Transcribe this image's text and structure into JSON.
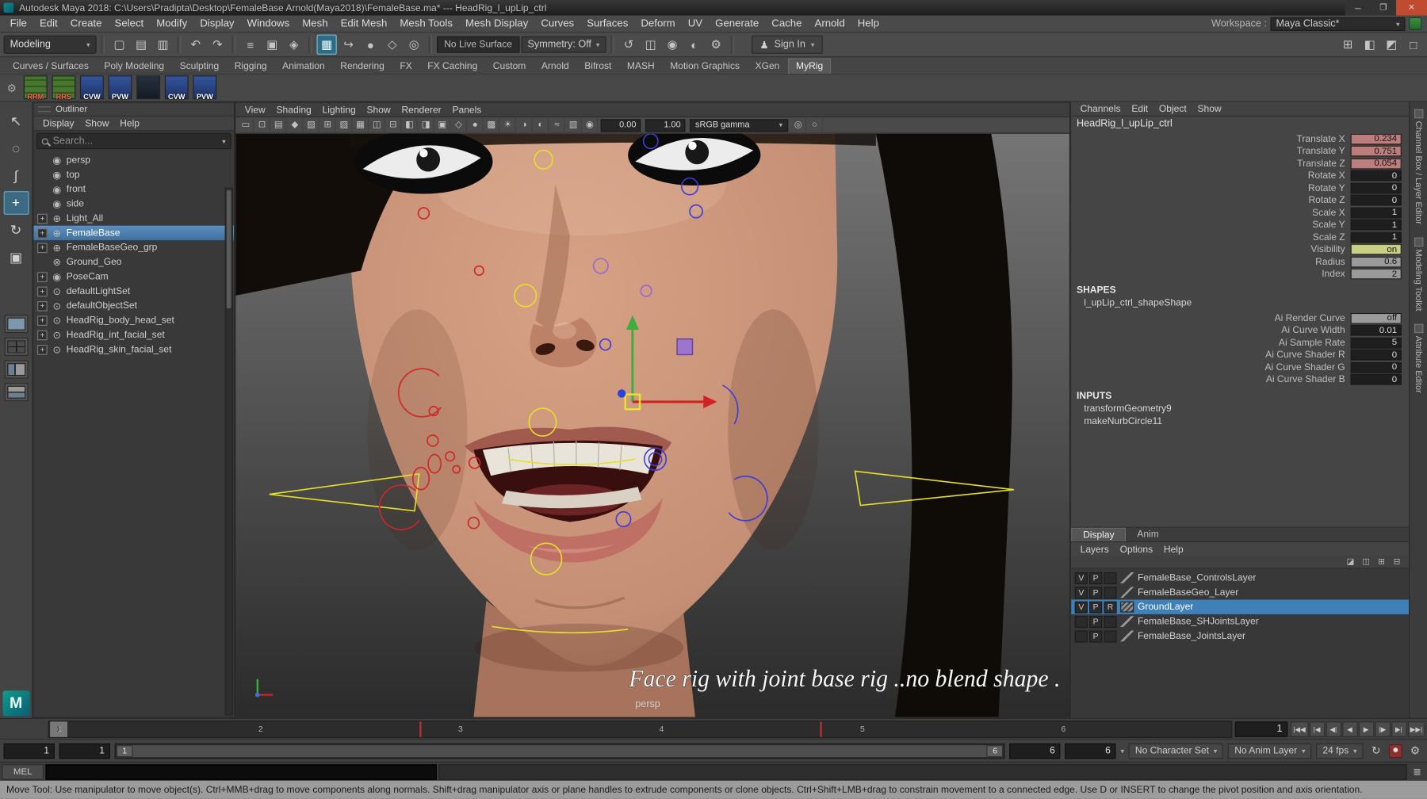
{
  "title_bar": {
    "title": "Autodesk Maya 2018: C:\\Users\\Pradipta\\Desktop\\FemaleBase Arnold(Maya2018)\\FemaleBase.ma*   ---   HeadRig_l_upLip_ctrl",
    "minimize": "─",
    "maximize": "❐",
    "close": "✕"
  },
  "menu_bar": {
    "items": [
      "File",
      "Edit",
      "Create",
      "Select",
      "Modify",
      "Display",
      "Windows",
      "Mesh",
      "Edit Mesh",
      "Mesh Tools",
      "Mesh Display",
      "Curves",
      "Surfaces",
      "Deform",
      "UV",
      "Generate",
      "Cache",
      "Arnold",
      "Help"
    ],
    "workspace_label": "Workspace :",
    "workspace_value": "Maya Classic*"
  },
  "status_line": {
    "mode": "Modeling",
    "live_surface": "No Live Surface",
    "symmetry": "Symmetry: Off",
    "sign_in": "Sign In",
    "icons": [
      {
        "name": "separator",
        "cls": "sep",
        "glyph": ""
      },
      {
        "name": "new-scene-icon",
        "cls": "",
        "glyph": "▢"
      },
      {
        "name": "open-scene-icon",
        "cls": "",
        "glyph": "▤"
      },
      {
        "name": "save-scene-icon",
        "cls": "",
        "glyph": "▥"
      },
      {
        "name": "separator",
        "cls": "sep",
        "glyph": ""
      },
      {
        "name": "undo-icon",
        "cls": "",
        "glyph": "↶"
      },
      {
        "name": "redo-icon",
        "cls": "",
        "glyph": "↷"
      },
      {
        "name": "separator",
        "cls": "sep",
        "glyph": ""
      },
      {
        "name": "select-by-hierarchy-icon",
        "cls": "",
        "glyph": "≡"
      },
      {
        "name": "select-by-object-icon",
        "cls": "",
        "glyph": "▣"
      },
      {
        "name": "select-by-component-icon",
        "cls": "",
        "glyph": "◈"
      },
      {
        "name": "separator",
        "cls": "sep",
        "glyph": ""
      },
      {
        "name": "snap-to-grid-icon",
        "cls": "active",
        "glyph": "▦"
      },
      {
        "name": "snap-to-curve-icon",
        "cls": "",
        "glyph": "↪"
      },
      {
        "name": "snap-to-point-icon",
        "cls": "",
        "glyph": "●"
      },
      {
        "name": "snap-to-plane-icon",
        "cls": "",
        "glyph": "◇"
      },
      {
        "name": "make-live-icon",
        "cls": "",
        "glyph": "◎"
      },
      {
        "name": "separator",
        "cls": "sep",
        "glyph": ""
      }
    ],
    "icons2": [
      {
        "name": "separator",
        "cls": "sep",
        "glyph": ""
      },
      {
        "name": "construction-history-icon",
        "cls": "",
        "glyph": "↺"
      },
      {
        "name": "open-render-view-icon",
        "cls": "",
        "glyph": "◫"
      },
      {
        "name": "render-current-frame-icon",
        "cls": "",
        "glyph": "◉"
      },
      {
        "name": "ipr-render-icon",
        "cls": "",
        "glyph": "◐"
      },
      {
        "name": "render-settings-icon",
        "cls": "",
        "glyph": "⚙"
      },
      {
        "name": "separator",
        "cls": "sep",
        "glyph": ""
      }
    ],
    "right_icons": [
      {
        "name": "toggle-grid-icon",
        "cls": "",
        "glyph": "⊞"
      },
      {
        "name": "toggle-panel-layout-icon",
        "cls": "",
        "glyph": "◧"
      },
      {
        "name": "toggle-viewcube-icon",
        "cls": "",
        "glyph": "◩"
      },
      {
        "name": "toggle-fullscreen-icon",
        "cls": "",
        "glyph": "□"
      }
    ]
  },
  "shelf": {
    "tabs": [
      {
        "label": "Curves / Surfaces",
        "cls": ""
      },
      {
        "label": "Poly Modeling",
        "cls": ""
      },
      {
        "label": "Sculpting",
        "cls": ""
      },
      {
        "label": "Rigging",
        "cls": ""
      },
      {
        "label": "Animation",
        "cls": ""
      },
      {
        "label": "Rendering",
        "cls": ""
      },
      {
        "label": "FX",
        "cls": ""
      },
      {
        "label": "FX Caching",
        "cls": ""
      },
      {
        "label": "Custom",
        "cls": ""
      },
      {
        "label": "Arnold",
        "cls": ""
      },
      {
        "label": "Bifrost",
        "cls": ""
      },
      {
        "label": "MASH",
        "cls": ""
      },
      {
        "label": "Motion Graphics",
        "cls": ""
      },
      {
        "label": "XGen",
        "cls": ""
      },
      {
        "label": "MyRig",
        "cls": "active"
      }
    ],
    "items": [
      {
        "name": "shelf-item-rrm",
        "label": "RRM",
        "color": "green"
      },
      {
        "name": "shelf-item-rrs",
        "label": "RRS",
        "color": "green"
      },
      {
        "name": "shelf-item-cvw-1",
        "label": "CVW",
        "color": "blue"
      },
      {
        "name": "shelf-item-pvw-1",
        "label": "PVW",
        "color": "blue"
      },
      {
        "name": "shelf-item-rig-head",
        "label": "",
        "color": "dark"
      },
      {
        "name": "shelf-item-cvw-2",
        "label": "CVW",
        "color": "blue"
      },
      {
        "name": "shelf-item-pvw-2",
        "label": "PVW",
        "color": "blue"
      }
    ]
  },
  "toolbox": {
    "tools": [
      {
        "name": "select-tool",
        "glyph": "↖",
        "cls": ""
      },
      {
        "name": "lasso-select-tool",
        "glyph": "◌",
        "cls": ""
      },
      {
        "name": "paint-select-tool",
        "glyph": "∫",
        "cls": ""
      },
      {
        "name": "move-tool",
        "glyph": "+",
        "cls": "active"
      },
      {
        "name": "rotate-tool",
        "glyph": "↻",
        "cls": ""
      },
      {
        "name": "scale-tool",
        "glyph": "▣",
        "cls": ""
      }
    ],
    "layouts": [
      {
        "name": "layout-single-pane-button",
        "kind": "single"
      },
      {
        "name": "layout-four-pane-button",
        "kind": "four"
      },
      {
        "name": "layout-persp-outliner-button",
        "kind": "split"
      },
      {
        "name": "layout-persp-graph-button",
        "kind": "hsplit"
      }
    ],
    "logo": "M"
  },
  "outliner": {
    "title": "Outliner",
    "menus": [
      "Display",
      "Show",
      "Help"
    ],
    "search_placeholder": "Search...",
    "items": [
      {
        "expander": "",
        "icon_glyph": "◉",
        "label": "persp",
        "cls": ""
      },
      {
        "expander": "",
        "icon_glyph": "◉",
        "label": "top",
        "cls": ""
      },
      {
        "expander": "",
        "icon_glyph": "◉",
        "label": "front",
        "cls": ""
      },
      {
        "expander": "",
        "icon_glyph": "◉",
        "label": "side",
        "cls": ""
      },
      {
        "expander": "+",
        "icon_glyph": "⊕",
        "label": "Light_All",
        "cls": ""
      },
      {
        "expander": "+",
        "icon_glyph": "⊕",
        "label": "FemaleBase",
        "cls": "selected"
      },
      {
        "expander": "+",
        "icon_glyph": "⊕",
        "label": "FemaleBaseGeo_grp",
        "cls": ""
      },
      {
        "expander": "",
        "icon_glyph": "⊗",
        "label": "Ground_Geo",
        "cls": ""
      },
      {
        "expander": "+",
        "icon_glyph": "◉",
        "label": "PoseCam",
        "cls": ""
      },
      {
        "expander": "+",
        "icon_glyph": "⊙",
        "label": "defaultLightSet",
        "cls": ""
      },
      {
        "expander": "+",
        "icon_glyph": "⊙",
        "label": "defaultObjectSet",
        "cls": ""
      },
      {
        "expander": "+",
        "icon_glyph": "⊙",
        "label": "HeadRig_body_head_set",
        "cls": ""
      },
      {
        "expander": "+",
        "icon_glyph": "⊙",
        "label": "HeadRig_int_facial_set",
        "cls": ""
      },
      {
        "expander": "+",
        "icon_glyph": "⊙",
        "label": "HeadRig_skin_facial_set",
        "cls": ""
      }
    ]
  },
  "viewport": {
    "menus": [
      "View",
      "Shading",
      "Lighting",
      "Show",
      "Renderer",
      "Panels"
    ],
    "icons": [
      {
        "name": "select-camera-icon",
        "glyph": "▭"
      },
      {
        "name": "lock-camera-icon",
        "glyph": "⊡"
      },
      {
        "name": "camera-attributes-icon",
        "glyph": "▤"
      },
      {
        "name": "bookmarks-icon",
        "glyph": "◆"
      },
      {
        "name": "image-plane-icon",
        "glyph": "▧"
      },
      {
        "name": "2d-pan-zoom-icon",
        "glyph": "⊞"
      },
      {
        "name": "oversampling-icon",
        "glyph": "▨"
      },
      {
        "name": "grid-icon",
        "glyph": "▦"
      },
      {
        "name": "film-gate-icon",
        "glyph": "◫"
      },
      {
        "name": "resolution-gate-icon",
        "glyph": "⊟"
      },
      {
        "name": "gate-mask-icon",
        "glyph": "◧"
      },
      {
        "name": "safe-action-icon",
        "glyph": "◨"
      },
      {
        "name": "safe-title-icon",
        "glyph": "▣"
      },
      {
        "name": "wireframe-icon",
        "glyph": "◇"
      },
      {
        "name": "shaded-icon",
        "glyph": "●"
      },
      {
        "name": "textured-icon",
        "glyph": "▩"
      },
      {
        "name": "use-all-lights-icon",
        "glyph": "☀"
      },
      {
        "name": "shadows-icon",
        "glyph": "◑"
      },
      {
        "name": "screen-space-ao-icon",
        "glyph": "◐"
      },
      {
        "name": "motion-blur-icon",
        "glyph": "≈"
      },
      {
        "name": "multisample-aa-icon",
        "glyph": "▥"
      },
      {
        "name": "depth-of-field-icon",
        "glyph": "◉"
      }
    ],
    "exposure": "0.00",
    "gamma": "1.00",
    "view_transform": "sRGB gamma",
    "icons_right": [
      {
        "name": "isolate-select-icon",
        "glyph": "◎"
      },
      {
        "name": "snapshot-icon",
        "glyph": "○"
      }
    ],
    "overlay_text": "Face rig  with joint base rig ..no blend shape .",
    "camera_label": "persp"
  },
  "channel_box": {
    "menus": [
      "Channels",
      "Edit",
      "Object",
      "Show"
    ],
    "node": "HeadRig_l_upLip_ctrl",
    "attrs": [
      {
        "label": "Translate X",
        "value": "0.234",
        "state": "keyed"
      },
      {
        "label": "Translate Y",
        "value": "0.751",
        "state": "keyed"
      },
      {
        "label": "Translate Z",
        "value": "0.054",
        "state": "keyed"
      },
      {
        "label": "Rotate X",
        "value": "0",
        "state": "plain"
      },
      {
        "label": "Rotate Y",
        "value": "0",
        "state": "plain"
      },
      {
        "label": "Rotate Z",
        "value": "0",
        "state": "plain"
      },
      {
        "label": "Scale X",
        "value": "1",
        "state": "plain"
      },
      {
        "label": "Scale Y",
        "value": "1",
        "state": "plain"
      },
      {
        "label": "Scale Z",
        "value": "1",
        "state": "plain"
      },
      {
        "label": "Visibility",
        "value": "on",
        "state": "on"
      },
      {
        "label": "Radius",
        "value": "0.6",
        "state": "gray"
      },
      {
        "label": "Index",
        "value": "2",
        "state": "gray"
      }
    ],
    "shapes_header": "SHAPES",
    "shape_node": "l_upLip_ctrl_shapeShape",
    "shape_attrs": [
      {
        "label": "Ai Render Curve",
        "value": "off",
        "state": "gray"
      },
      {
        "label": "Ai Curve Width",
        "value": "0.01",
        "state": "plain"
      },
      {
        "label": "Ai Sample Rate",
        "value": "5",
        "state": "plain"
      },
      {
        "label": "Ai Curve Shader R",
        "value": "0",
        "state": "plain"
      },
      {
        "label": "Ai Curve Shader G",
        "value": "0",
        "state": "plain"
      },
      {
        "label": "Ai Curve Shader B",
        "value": "0",
        "state": "plain"
      }
    ],
    "inputs_header": "INPUTS",
    "inputs": [
      "transformGeometry9",
      "makeNurbCircle11"
    ]
  },
  "layer_editor": {
    "tabs": [
      {
        "label": "Display",
        "cls": "active"
      },
      {
        "label": "Anim",
        "cls": ""
      }
    ],
    "menus": [
      "Layers",
      "Options",
      "Help"
    ],
    "icons": [
      {
        "name": "layer-move-icon",
        "glyph": "◪"
      },
      {
        "name": "layer-edit-icon",
        "glyph": "◫"
      },
      {
        "name": "new-empty-layer-icon",
        "glyph": "⊞"
      },
      {
        "name": "new-layer-from-selected-icon",
        "glyph": "⊟"
      }
    ],
    "layers": [
      {
        "v": "V",
        "p": "P",
        "r": "",
        "chip": "slash",
        "name": "FemaleBase_ControlsLayer",
        "cls": ""
      },
      {
        "v": "V",
        "p": "P",
        "r": "",
        "chip": "slash",
        "name": "FemaleBaseGeo_Layer",
        "cls": ""
      },
      {
        "v": "V",
        "p": "P",
        "r": "R",
        "chip": "hatch",
        "name": "GroundLayer",
        "cls": "selected"
      },
      {
        "v": "",
        "p": "P",
        "r": "",
        "chip": "slash",
        "name": "FemaleBase_SHJointsLayer",
        "cls": ""
      },
      {
        "v": "",
        "p": "P",
        "r": "",
        "chip": "slash",
        "name": "FemaleBase_JointsLayer",
        "cls": ""
      }
    ]
  },
  "side_tabs": [
    "Channel Box / Layer Editor",
    "Modeling Toolkit",
    "Attribute Editor"
  ],
  "timeline": {
    "current": "1",
    "ticks": [
      {
        "label": "1",
        "style": "left:0.7%"
      },
      {
        "label": "2",
        "style": "left:17.7%"
      },
      {
        "label": "3",
        "style": "left:34.6%"
      },
      {
        "label": "4",
        "style": "left:51.6%"
      },
      {
        "label": "5",
        "style": "left:68.6%"
      },
      {
        "label": "6",
        "style": "left:85.6%"
      }
    ],
    "keys": [
      {
        "style": "left:31.3%"
      },
      {
        "style": "left:65.2%"
      }
    ],
    "playback": [
      {
        "name": "go-to-start-button",
        "glyph": "|◀◀"
      },
      {
        "name": "step-back-frame-button",
        "glyph": "|◀"
      },
      {
        "name": "step-back-key-button",
        "glyph": "◀|"
      },
      {
        "name": "play-backwards-button",
        "glyph": "◀"
      },
      {
        "name": "play-forward-button",
        "glyph": "▶"
      },
      {
        "name": "step-forward-key-button",
        "glyph": "|▶"
      },
      {
        "name": "step-forward-frame-button",
        "glyph": "▶|"
      },
      {
        "name": "go-to-end-button",
        "glyph": "▶▶|"
      }
    ]
  },
  "range_slider": {
    "anim_start": "1",
    "play_start": "1",
    "handle_left": "1",
    "handle_right": "6",
    "play_end": "6",
    "anim_end": "6",
    "character_set": "No Character Set",
    "anim_layer": "No Anim Layer",
    "fps": "24 fps"
  },
  "command_line": {
    "label": "MEL"
  },
  "help_line": "Move Tool: Use manipulator to move object(s). Ctrl+MMB+drag to move components along normals. Shift+drag manipulator axis or plane handles to extrude components or clone objects. Ctrl+Shift+LMB+drag to constrain movement to a connected edge. Use D or INSERT to change the pivot position and axis orientation."
}
